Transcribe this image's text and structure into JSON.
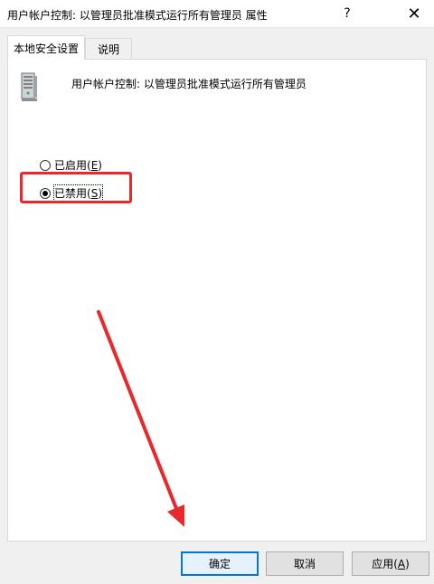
{
  "window": {
    "title": "用户帐户控制: 以管理员批准模式运行所有管理员 属性",
    "help_glyph": "?",
    "close_glyph": "✕"
  },
  "tabs": [
    {
      "label": "本地安全设置",
      "active": true
    },
    {
      "label": "说明",
      "active": false
    }
  ],
  "policy": {
    "icon": "server-policy-icon",
    "name": "用户帐户控制: 以管理员批准模式运行所有管理员"
  },
  "options": [
    {
      "label": "已启用(",
      "mnemonic": "E",
      "suffix": ")",
      "checked": false
    },
    {
      "label": "已禁用(",
      "mnemonic": "S",
      "suffix": ")",
      "checked": true
    }
  ],
  "annotation": {
    "highlight_color": "#e8282b",
    "highlight_target": "已禁用(S)",
    "arrow_target": "确定"
  },
  "buttons": {
    "ok": "确定",
    "cancel": "取消",
    "apply_label": "应用(",
    "apply_mnemonic": "A",
    "apply_suffix": ")"
  },
  "colors": {
    "accent": "#0078d7",
    "window_bg": "#f0f0f0",
    "panel_bg": "#ffffff"
  }
}
